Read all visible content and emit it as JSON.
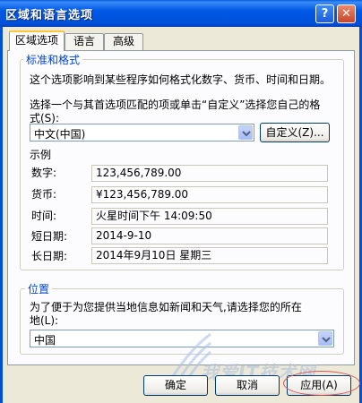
{
  "window": {
    "title": "区域和语言选项",
    "help_glyph": "?",
    "close_glyph": "✕"
  },
  "tabs": [
    {
      "label": "区域选项",
      "active": true
    },
    {
      "label": "语言",
      "active": false
    },
    {
      "label": "高级",
      "active": false
    }
  ],
  "standards": {
    "legend": "标准和格式",
    "description": "这个选项影响到某些程序如何格式化数字、货币、时间和日期。",
    "instruction_line1": "选择一个与其首选项匹配的项或单击“自定义”选择您自己的格",
    "instruction_line2": "式(S):",
    "locale_value": "中文(中国)",
    "customize_label": "自定义(Z)..."
  },
  "samples": {
    "heading": "示例",
    "rows": [
      {
        "label": "数字:",
        "value": "123,456,789.00"
      },
      {
        "label": "货币:",
        "value": "¥123,456,789.00"
      },
      {
        "label": "时间:",
        "value": "火星时间下午 14:09:50"
      },
      {
        "label": "短日期:",
        "value": "2014-9-10"
      },
      {
        "label": "长日期:",
        "value": "2014年9月10日 星期三"
      }
    ]
  },
  "location": {
    "legend": "位置",
    "description_line1": "为了便于为您提供当地信息如新闻和天气,请选择您的所在",
    "description_line2": "地(L):",
    "value": "中国"
  },
  "footer": {
    "ok_label": "确定",
    "cancel_label": "取消",
    "apply_label": "应用(A)"
  },
  "watermark": "我爱IT技术网",
  "colors": {
    "titlebar": "#0054E3",
    "window_bg": "#ECE9D8",
    "panel_bg": "#FCFCFE",
    "group_label": "#0046D5",
    "annotation": "#D9534F"
  }
}
